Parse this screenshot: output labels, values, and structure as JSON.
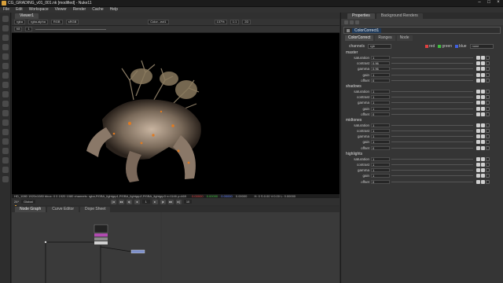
{
  "window": {
    "title": "CG_GRADING_v01_001.nk [modified] - Nuke11"
  },
  "menu": [
    "File",
    "Edit",
    "Workspace",
    "Viewer",
    "Render",
    "Cache",
    "Help"
  ],
  "viewer": {
    "tab": "Viewer1",
    "channels": "rgba",
    "display_channel": "rgba.alpha",
    "colorspace_in": "RGB",
    "colorspace_out": "sRGB",
    "gain_label": "f/8",
    "gain_value": "1",
    "node_a": "Color...ect1",
    "zoom": "137%",
    "proxy": "1:1",
    "frame_type": "2D",
    "info": "HD_1080 1920x1080  bbox: 0 0 1920 1080 channels: rgba,RGBA_lightgrp1,RGBA_lightgrp2,RGBA_lightgrp3  x=1146 y=469",
    "pixel_r": "0.00000",
    "pixel_g": "0.00000",
    "pixel_b": "0.00000",
    "pixel_a": "0.00000",
    "hsv": "H: 0  S:0.00  V:0.00  L: 0.00000",
    "timeline_ticks": [
      "1",
      "10",
      "20",
      "30",
      "40",
      "50",
      "60",
      "70",
      "80",
      "90",
      "100"
    ],
    "fps": "24*",
    "global": "Global",
    "frame": "1",
    "step": "10"
  },
  "bottom_tabs": [
    "Node Graph",
    "Curve Editor",
    "Dope Sheet"
  ],
  "properties": {
    "tabs": [
      "Properties",
      "Background Renders"
    ],
    "node_name": "ColorCorrect1",
    "subtabs": [
      "ColorCorrect",
      "Ranges",
      "Node"
    ],
    "channels_label": "channels",
    "channels_value": "rgb",
    "channel_checks": [
      "red",
      "green",
      "blue",
      "none"
    ],
    "groups": [
      {
        "name": "master",
        "params": [
          {
            "label": "saturation",
            "value": "1"
          },
          {
            "label": "contrast",
            "value": "0.96"
          },
          {
            "label": "gamma",
            "value": "0.96"
          },
          {
            "label": "gain",
            "value": "1"
          },
          {
            "label": "offset",
            "value": "0"
          }
        ]
      },
      {
        "name": "shadows",
        "params": [
          {
            "label": "saturation",
            "value": "1"
          },
          {
            "label": "contrast",
            "value": "1"
          },
          {
            "label": "gamma",
            "value": "1"
          },
          {
            "label": "gain",
            "value": "1"
          },
          {
            "label": "offset",
            "value": "0"
          }
        ]
      },
      {
        "name": "midtones",
        "params": [
          {
            "label": "saturation",
            "value": "1"
          },
          {
            "label": "contrast",
            "value": "1"
          },
          {
            "label": "gamma",
            "value": "1"
          },
          {
            "label": "gain",
            "value": "1"
          },
          {
            "label": "offset",
            "value": "0"
          }
        ]
      },
      {
        "name": "highlights",
        "params": [
          {
            "label": "saturation",
            "value": "1"
          },
          {
            "label": "contrast",
            "value": "1"
          },
          {
            "label": "gamma",
            "value": "1"
          },
          {
            "label": "gain",
            "value": "1"
          },
          {
            "label": "offset",
            "value": "0"
          }
        ]
      }
    ]
  },
  "colors": {
    "accent": "#d9a13b",
    "selected_node": "#7c8fc9",
    "red": "#e04040",
    "green": "#40c040",
    "blue": "#4060e0"
  }
}
